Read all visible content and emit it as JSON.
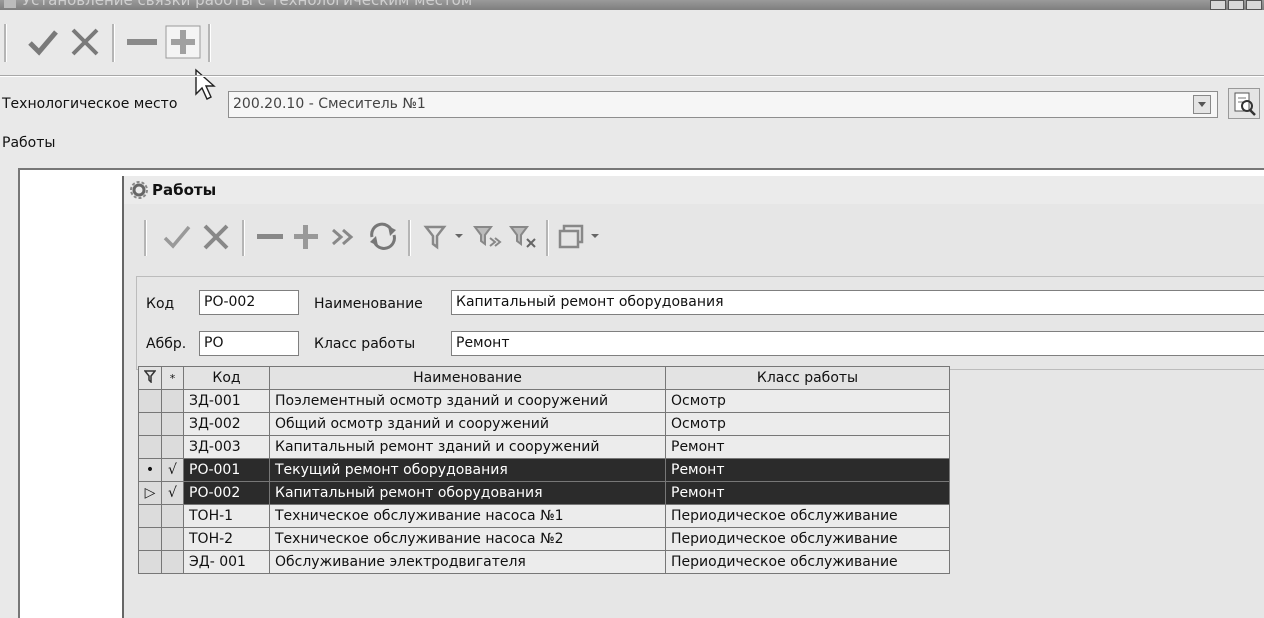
{
  "window": {
    "title": "Установление связки работы с технологическим местом"
  },
  "form": {
    "tech_place_label": "Технологическое место",
    "tech_place_value": "200.20.10 - Смеситель №1",
    "works_label": "Работы"
  },
  "works_window": {
    "title": "Работы",
    "fields": {
      "code_label": "Код",
      "code_value": "РО-002",
      "name_label": "Наименование",
      "name_value": "Капитальный ремонт оборудования",
      "abbr_label": "Аббр.",
      "abbr_value": "РО",
      "class_label": "Класс работы",
      "class_value": "Ремонт"
    },
    "grid": {
      "columns": [
        "Код",
        "Наименование",
        "Класс работы"
      ],
      "rows": [
        {
          "ind": "",
          "mark": "",
          "code": "ЗД-001",
          "name": "Поэлементный осмотр зданий и сооружений",
          "cls": "Осмотр"
        },
        {
          "ind": "",
          "mark": "",
          "code": "ЗД-002",
          "name": "Общий осмотр зданий и сооружений",
          "cls": "Осмотр"
        },
        {
          "ind": "",
          "mark": "",
          "code": "ЗД-003",
          "name": "Капитальный ремонт зданий и сооружений",
          "cls": "Ремонт"
        },
        {
          "ind": "•",
          "mark": "√",
          "code": "РО-001",
          "name": "Текущий ремонт оборудования",
          "cls": "Ремонт"
        },
        {
          "ind": "▷",
          "mark": "√",
          "code": "РО-002",
          "name": "Капитальный ремонт оборудования",
          "cls": "Ремонт"
        },
        {
          "ind": "",
          "mark": "",
          "code": "ТОН-1",
          "name": "Техническое обслуживание насоса №1",
          "cls": "Периодическое обслуживание"
        },
        {
          "ind": "",
          "mark": "",
          "code": "ТОН-2",
          "name": "Техническое обслуживание насоса №2",
          "cls": "Периодическое обслуживание"
        },
        {
          "ind": "",
          "mark": "",
          "code": "ЭД- 001",
          "name": "Обслуживание электродвигателя",
          "cls": "Периодическое обслуживание"
        }
      ]
    }
  },
  "colors": {
    "selected_row": "#2b2b2b",
    "background": "#e9e9e9"
  },
  "icons": [
    "check-icon",
    "cross-icon",
    "minus-icon",
    "plus-icon",
    "cursor-icon",
    "double-chevron-icon",
    "refresh-icon",
    "filter-icon",
    "filter-apply-icon",
    "filter-clear-icon",
    "window-icon",
    "dropdown-arrow-icon",
    "lookup-icon",
    "gear-icon"
  ]
}
